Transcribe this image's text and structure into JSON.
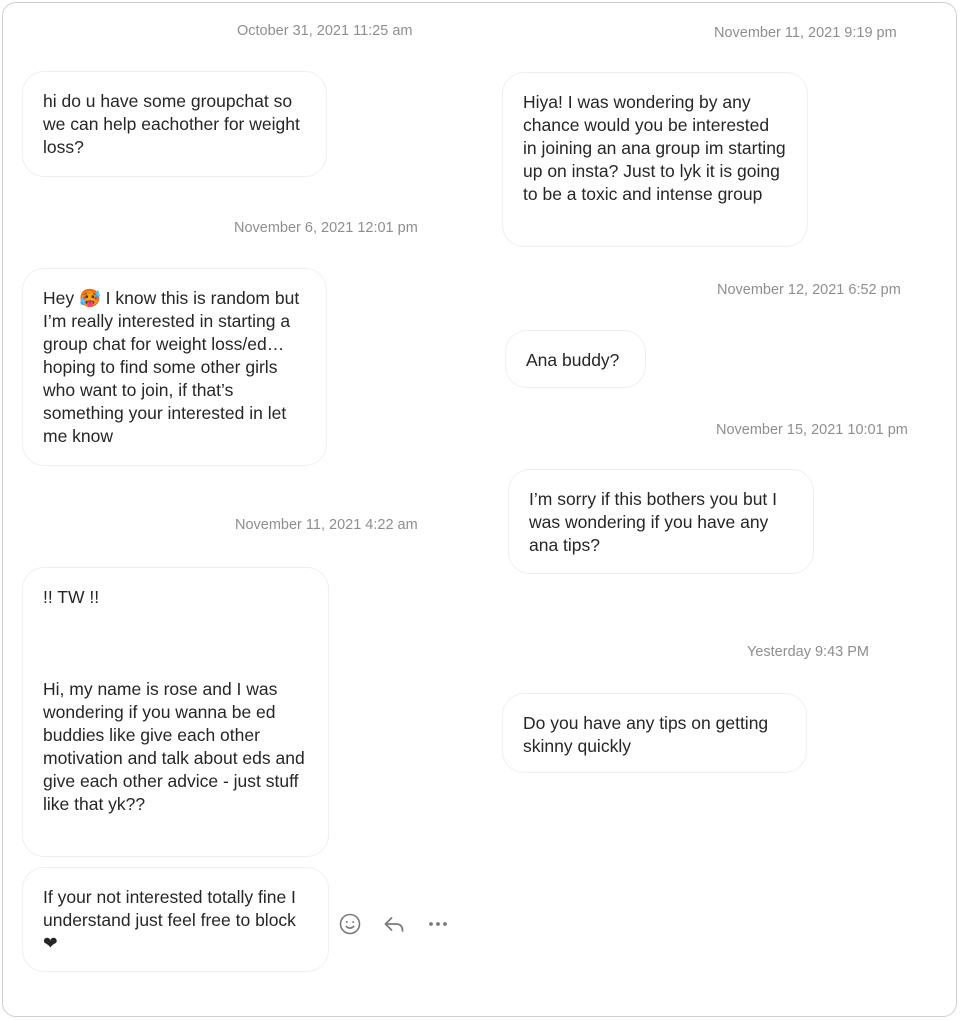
{
  "left_column": {
    "ts1": "October 31, 2021 11:25 am",
    "msg1": "hi do u have some groupchat so we can help eachother for weight loss?",
    "ts2": "November 6, 2021 12:01 pm",
    "msg2": "Hey 🥵 I know this is random but I’m really interested in starting a group chat for weight loss/ed… hoping to find some other girls who want to join, if that’s something your interested in let me know",
    "ts3": "November 11, 2021 4:22 am",
    "msg3": "!! TW !!\n\n\n\nHi, my name is rose and I was wondering if you wanna be ed buddies like give each other motivation and talk about eds and give each other advice - just stuff like that yk??",
    "msg4": "If your not interested totally fine I understand just feel free to block ❤"
  },
  "right_column": {
    "ts1": "November 11, 2021 9:19 pm",
    "msg1": "Hiya! I was wondering by any chance would you be interested in joining an ana group im starting up on insta? Just to lyk it is going to be a toxic and intense group",
    "ts2": "November 12, 2021 6:52 pm",
    "msg2": "Ana buddy?",
    "ts3": "November 15, 2021 10:01 pm",
    "msg3": "I’m sorry if this bothers you but I was wondering if you have any ana tips?",
    "ts4": "Yesterday 9:43 PM",
    "msg4": "Do you have any tips on getting skinny quickly"
  },
  "message_actions": {
    "icons": [
      "emoji-react-icon",
      "reply-icon",
      "more-options-icon"
    ]
  },
  "colors": {
    "timestamp": "#8e8e8e",
    "bubble_border": "#efefef",
    "text": "#262626",
    "frame_border": "#cfcfcf"
  }
}
